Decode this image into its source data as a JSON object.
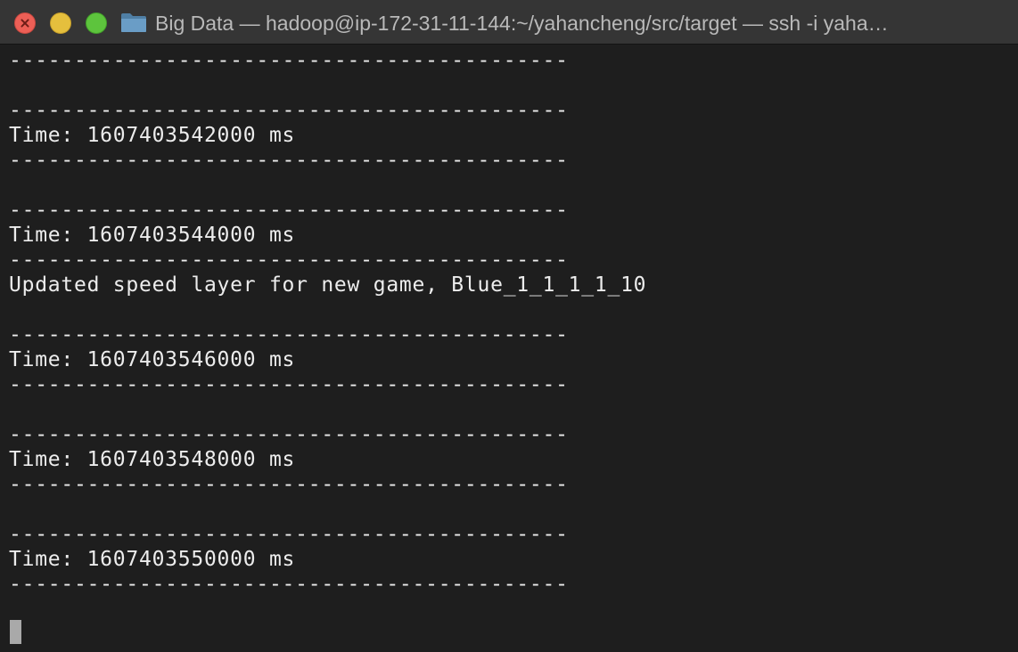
{
  "window": {
    "title": "Big Data — hadoop@ip-172-31-11-144:~/yahancheng/src/target — ssh -i yaha…",
    "title_icon": "folder-icon",
    "controls": [
      "close",
      "minimize",
      "zoom"
    ]
  },
  "colors": {
    "background": "#1e1e1e",
    "text": "#ececec",
    "titlebar": "#353535",
    "title_text": "#b9b9b9",
    "close": "#ec5f56",
    "minimize": "#e5bf3d",
    "zoom": "#5dc43d",
    "cursor": "#a9a9a9"
  },
  "terminal": {
    "lines": [
      "-------------------------------------------",
      "",
      "-------------------------------------------",
      "Time: 1607403542000 ms",
      "-------------------------------------------",
      "",
      "-------------------------------------------",
      "Time: 1607403544000 ms",
      "-------------------------------------------",
      "Updated speed layer for new game, Blue_1_1_1_1_10",
      "",
      "-------------------------------------------",
      "Time: 1607403546000 ms",
      "-------------------------------------------",
      "",
      "-------------------------------------------",
      "Time: 1607403548000 ms",
      "-------------------------------------------",
      "",
      "-------------------------------------------",
      "Time: 1607403550000 ms",
      "-------------------------------------------"
    ]
  }
}
